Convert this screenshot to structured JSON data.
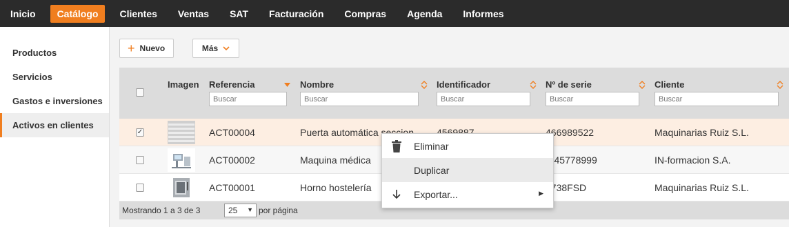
{
  "nav": {
    "items": [
      {
        "label": "Inicio"
      },
      {
        "label": "Catálogo"
      },
      {
        "label": "Clientes"
      },
      {
        "label": "Ventas"
      },
      {
        "label": "SAT"
      },
      {
        "label": "Facturación"
      },
      {
        "label": "Compras"
      },
      {
        "label": "Agenda"
      },
      {
        "label": "Informes"
      }
    ],
    "active": "Catálogo",
    "accent_color": "#f07e1f"
  },
  "sidebar": {
    "items": [
      {
        "label": "Productos"
      },
      {
        "label": "Servicios"
      },
      {
        "label": "Gastos e inversiones"
      },
      {
        "label": "Activos en clientes"
      }
    ],
    "active": "Activos en clientes"
  },
  "toolbar": {
    "new_label": "Nuevo",
    "more_label": "Más"
  },
  "table": {
    "columns": {
      "image": "Imagen",
      "reference": "Referencia",
      "name": "Nombre",
      "identifier": "Identificador",
      "serial": "Nº de serie",
      "client": "Cliente"
    },
    "filter_placeholder": "Buscar",
    "rows": [
      {
        "reference": "ACT00004",
        "name": "Puerta automática seccion",
        "identifier": "4569887",
        "serial": "466989522",
        "client": "Maquinarias Ruiz S.L.",
        "checked": true,
        "image": "garage-door"
      },
      {
        "reference": "ACT00002",
        "name": "Maquina médica",
        "identifier": "",
        "serial": "T-45778999",
        "client": "IN-formacion S.A.",
        "checked": false,
        "image": "medical-machine"
      },
      {
        "reference": "ACT00001",
        "name": "Horno hostelería",
        "identifier": "",
        "serial": "1738FSD",
        "client": "Maquinarias Ruiz S.L.",
        "checked": false,
        "image": "oven"
      }
    ],
    "footer": {
      "showing": "Mostrando 1 a 3 de 3",
      "per_page_value": "25",
      "per_page_label": "por página"
    }
  },
  "context_menu": {
    "items": [
      {
        "label": "Eliminar",
        "icon": "trash-icon"
      },
      {
        "label": "Duplicar",
        "icon": ""
      },
      {
        "label": "Exportar...",
        "icon": "arrow-down-icon"
      }
    ]
  }
}
